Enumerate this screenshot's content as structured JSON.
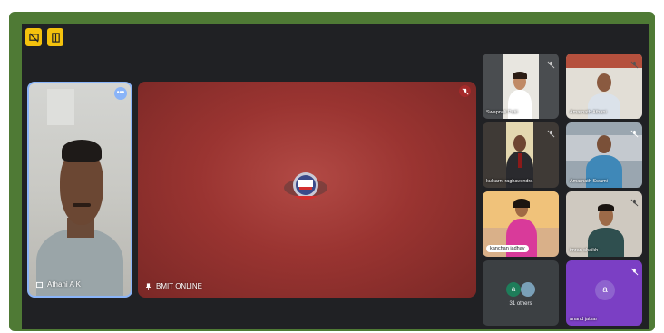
{
  "toolbar": {
    "btn1_icon": "screen-off-icon",
    "btn2_icon": "panel-icon"
  },
  "self_tile": {
    "name": "Athani A K",
    "more_icon": "more-icon",
    "more_glyph": "•••"
  },
  "main_tile": {
    "name": "BMIT ONLINE",
    "pin_icon": "pin-icon",
    "mic_icon": "mic-off-icon"
  },
  "participants": [
    {
      "name": "Swapnali Patil"
    },
    {
      "name": "Amarnath Athani"
    },
    {
      "name": "kulkarni raghavendra"
    },
    {
      "name": "Amarnath Swami"
    },
    {
      "name": "kanchan jadhav"
    },
    {
      "name": "imran shaikh"
    }
  ],
  "others": {
    "label": "31 others",
    "avatar_letter": "a"
  },
  "anand": {
    "name": "anand jatsar",
    "avatar_letter": "a",
    "color": "#7b3fc4"
  },
  "colors": {
    "frame": "#4f7a35",
    "window": "#202124",
    "accent": "#8ab4f8",
    "toolbar_btn": "#f4c20d"
  }
}
